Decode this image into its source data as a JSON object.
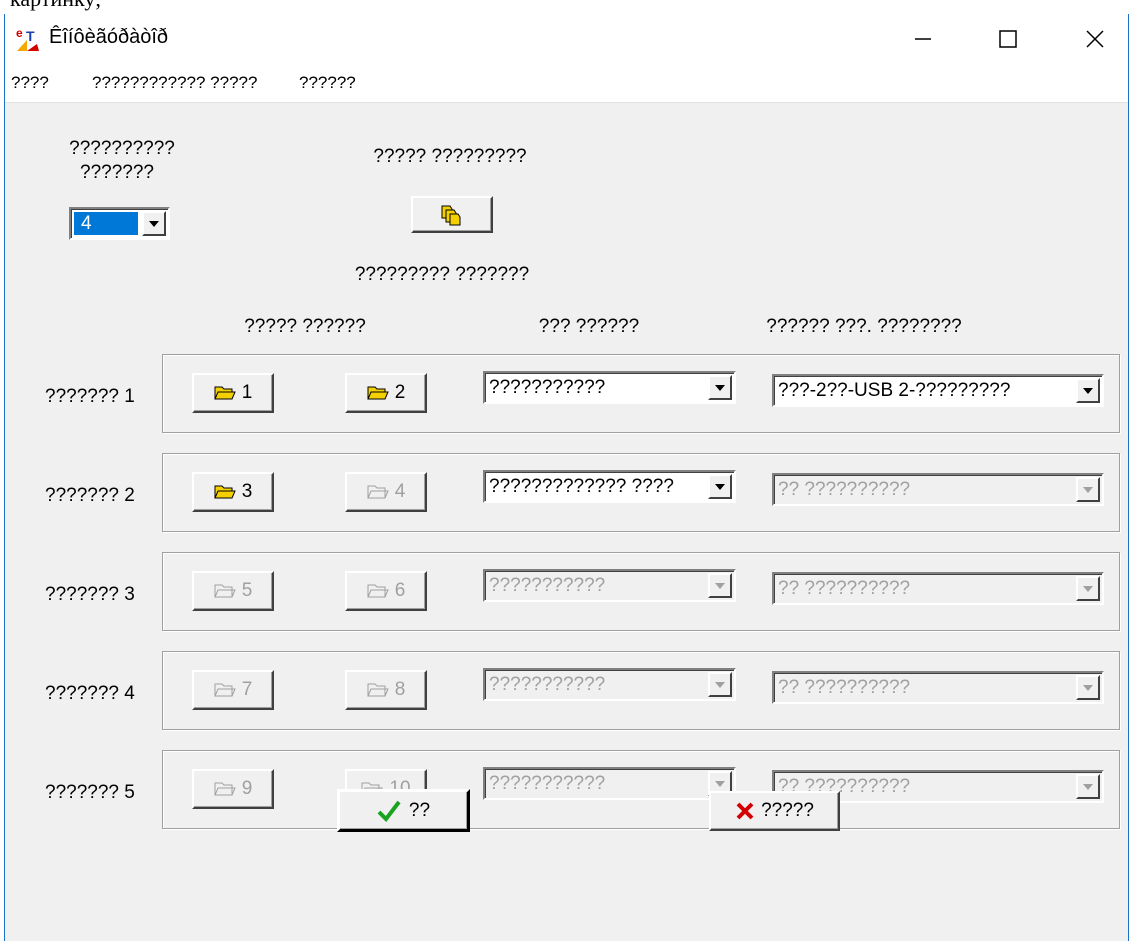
{
  "page_top_fragment": "картинку;",
  "window": {
    "title": "Êîíôèãóðàòîð"
  },
  "menu": [
    "????",
    "???????????? ?????",
    "??????"
  ],
  "devices_label_line1": "??????????",
  "devices_label_line2": "???????",
  "devices_count": "4",
  "open_button_label": "????? ?????????",
  "section_title": "????????? ???????",
  "col_headers": {
    "files": "????? ??????",
    "type": "??? ??????",
    "interface": "?????? ???. ????????"
  },
  "rows": [
    {
      "label": "??????? 1",
      "b1": "1",
      "b2": "2",
      "b1_enabled": true,
      "b2_enabled": true,
      "type": "???????????",
      "type_enabled": true,
      "interface": "???-2??-USB 2-?????????",
      "interface_enabled": true
    },
    {
      "label": "??????? 2",
      "b1": "3",
      "b2": "4",
      "b1_enabled": true,
      "b2_enabled": false,
      "type": "????????????? ????",
      "type_enabled": true,
      "interface": "?? ??????????",
      "interface_enabled": false
    },
    {
      "label": "??????? 3",
      "b1": "5",
      "b2": "6",
      "b1_enabled": false,
      "b2_enabled": false,
      "type": "???????????",
      "type_enabled": false,
      "interface": "?? ??????????",
      "interface_enabled": false
    },
    {
      "label": "??????? 4",
      "b1": "7",
      "b2": "8",
      "b1_enabled": false,
      "b2_enabled": false,
      "type": "???????????",
      "type_enabled": false,
      "interface": "?? ??????????",
      "interface_enabled": false
    },
    {
      "label": "??????? 5",
      "b1": "9",
      "b2": "10",
      "b1_enabled": false,
      "b2_enabled": false,
      "type": "???????????",
      "type_enabled": false,
      "interface": "?? ??????????",
      "interface_enabled": false
    }
  ],
  "ok_label": "??",
  "cancel_label": "?????",
  "icons": {
    "app": "configurator-app-icon",
    "open": "folders-icon",
    "folder": "folder-open-icon",
    "ok": "checkmark-icon",
    "cancel": "cross-icon"
  },
  "colors": {
    "highlight": "#0078d7",
    "folder": "#f5d000",
    "ok": "#1aa320",
    "cancel": "#d40000",
    "window_border": "#1a73c9"
  }
}
